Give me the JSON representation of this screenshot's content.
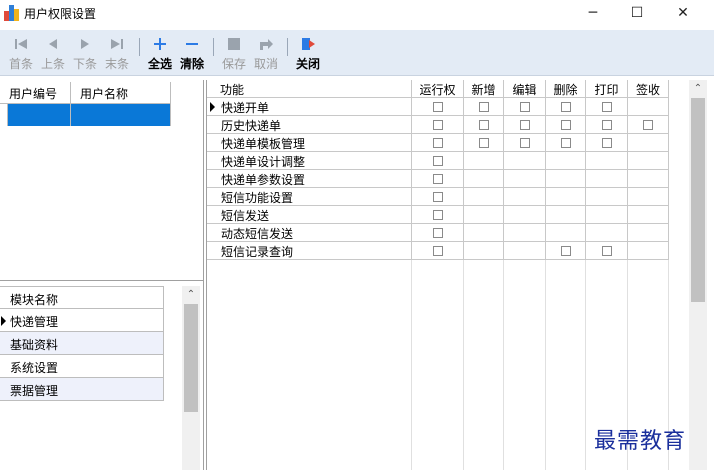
{
  "window": {
    "title": "用户权限设置",
    "controls": {
      "minimize": "─",
      "maximize": "☐",
      "close": "✕"
    }
  },
  "toolbar": {
    "first": "首条",
    "prev": "上条",
    "next": "下条",
    "last": "末条",
    "select_all": "全选",
    "clear": "清除",
    "save": "保存",
    "cancel": "取消",
    "close": "关闭"
  },
  "user_grid": {
    "columns": [
      "用户编号",
      "用户名称"
    ],
    "selected_row": [
      "",
      ""
    ]
  },
  "module_grid": {
    "column": "模块名称",
    "rows": [
      "快递管理",
      "基础资料",
      "系统设置",
      "票据管理"
    ],
    "current_row": 0
  },
  "permission_grid": {
    "columns": [
      "功能",
      "运行权",
      "新增",
      "编辑",
      "删除",
      "打印",
      "签收"
    ],
    "rows": [
      {
        "name": "快递开单",
        "run": true,
        "add": true,
        "edit": true,
        "delete": true,
        "print": true,
        "sign": false
      },
      {
        "name": "历史快递单",
        "run": true,
        "add": true,
        "edit": true,
        "delete": true,
        "print": true,
        "sign": true
      },
      {
        "name": "快递单模板管理",
        "run": true,
        "add": true,
        "edit": true,
        "delete": true,
        "print": true,
        "sign": false
      },
      {
        "name": "快递单设计调整",
        "run": true,
        "add": false,
        "edit": false,
        "delete": false,
        "print": false,
        "sign": false
      },
      {
        "name": "快递单参数设置",
        "run": true,
        "add": false,
        "edit": false,
        "delete": false,
        "print": false,
        "sign": false
      },
      {
        "name": "短信功能设置",
        "run": true,
        "add": false,
        "edit": false,
        "delete": false,
        "print": false,
        "sign": false
      },
      {
        "name": "短信发送",
        "run": true,
        "add": false,
        "edit": false,
        "delete": false,
        "print": false,
        "sign": false
      },
      {
        "name": "动态短信发送",
        "run": true,
        "add": false,
        "edit": false,
        "delete": false,
        "print": false,
        "sign": false
      },
      {
        "name": "短信记录查询",
        "run": true,
        "add": false,
        "edit": false,
        "delete": true,
        "print": true,
        "sign": false
      }
    ],
    "current_row": 0
  },
  "watermark": "最需教育",
  "colors": {
    "selection": "#0a78d7",
    "toolbar_bg": "#e3ebf5",
    "watermark": "#1a2f9c",
    "accent_icon": "#2c7be5"
  }
}
